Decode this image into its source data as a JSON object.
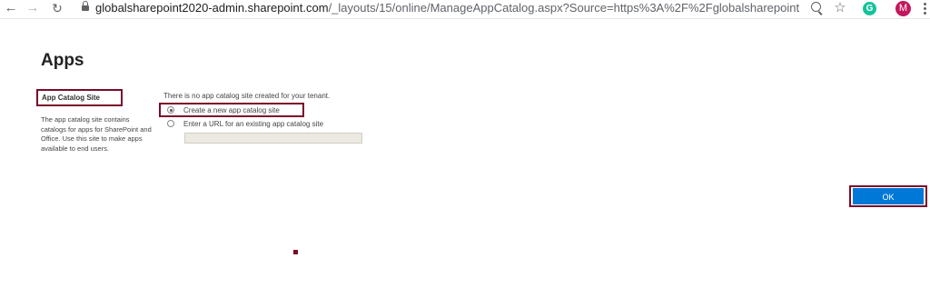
{
  "browser": {
    "url_host": "globalsharepoint2020-admin.sharepoint.com",
    "url_path": "/_layouts/15/online/ManageAppCatalog.aspx?Source=https%3A%2F%2Fglobalsharepoint2020-admin%2E...",
    "avatar_letter": "M",
    "grammarly_letter": "G"
  },
  "page": {
    "title": "Apps"
  },
  "section": {
    "title": "App Catalog Site",
    "description": "The app catalog site contains catalogs for apps for SharePoint and Office. Use this site to make apps available to end users."
  },
  "form": {
    "status_text": "There is no app catalog site created for your tenant.",
    "option_create": "Create a new app catalog site",
    "option_url": "Enter a URL for an existing app catalog site",
    "url_value": "",
    "selected": "create"
  },
  "actions": {
    "ok_label": "OK"
  },
  "colors": {
    "highlight": "#7a0a2a",
    "ok_button": "#0078d7"
  }
}
